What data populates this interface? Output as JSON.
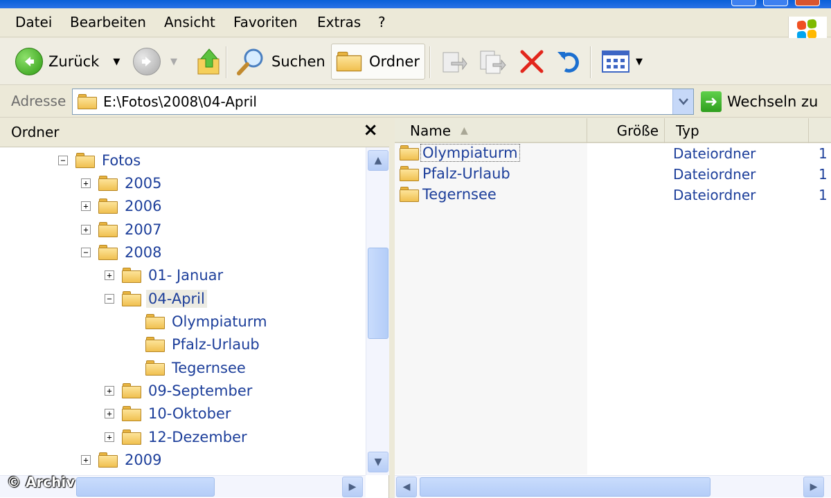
{
  "menu": [
    "Datei",
    "Bearbeiten",
    "Ansicht",
    "Favoriten",
    "Extras",
    "?"
  ],
  "toolbar": {
    "back_label": "Zurück",
    "search_label": "Suchen",
    "folders_label": "Ordner"
  },
  "address": {
    "label": "Adresse",
    "path": "E:\\Fotos\\2008\\04-April",
    "go_label": "Wechseln zu"
  },
  "folder_pane": {
    "title": "Ordner",
    "close_glyph": "×",
    "tree": [
      {
        "label": "Fotos",
        "expander": "−"
      },
      {
        "label": "2005",
        "expander": "+"
      },
      {
        "label": "2006",
        "expander": "+"
      },
      {
        "label": "2007",
        "expander": "+"
      },
      {
        "label": "2008",
        "expander": "−"
      },
      {
        "label": "01- Januar",
        "expander": "+"
      },
      {
        "label": "04-April",
        "expander": "−"
      },
      {
        "label": "Olympiaturm",
        "expander": ""
      },
      {
        "label": "Pfalz-Urlaub",
        "expander": ""
      },
      {
        "label": "Tegernsee",
        "expander": ""
      },
      {
        "label": "09-September",
        "expander": "+"
      },
      {
        "label": "10-Oktober",
        "expander": "+"
      },
      {
        "label": "12-Dezember",
        "expander": "+"
      },
      {
        "label": "2009",
        "expander": "+"
      }
    ]
  },
  "content": {
    "columns": {
      "name": "Name",
      "size": "Größe",
      "type": "Typ"
    },
    "files": [
      {
        "name": "Olympiaturm",
        "type": "Dateiordner",
        "extra": "1"
      },
      {
        "name": "Pfalz-Urlaub",
        "type": "Dateiordner",
        "extra": "1"
      },
      {
        "name": "Tegernsee",
        "type": "Dateiordner",
        "extra": "1"
      }
    ]
  },
  "watermark": "© Archiv",
  "colors": {
    "accent_blue": "#1c3e9a",
    "chrome": "#ece9d8",
    "folder_yellow": "#f0c050"
  }
}
